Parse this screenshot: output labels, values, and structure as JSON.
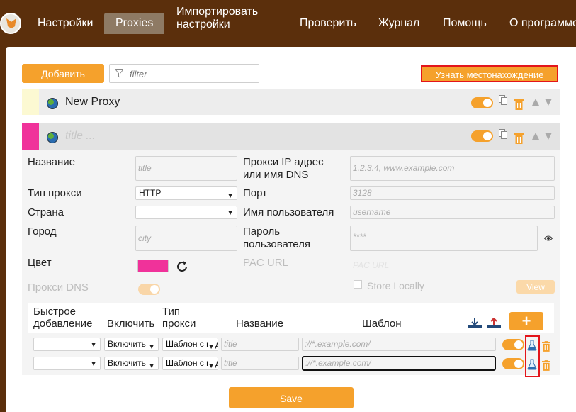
{
  "nav": {
    "tabs": [
      {
        "label": "Настройки"
      },
      {
        "label": "Proxies"
      },
      {
        "label": "Импортировать настройки",
        "line1": "Импортировать",
        "line2": "настройки"
      },
      {
        "label": "Проверить"
      },
      {
        "label": "Журнал"
      },
      {
        "label": "Помощь"
      },
      {
        "label": "О программе"
      }
    ]
  },
  "toolbar": {
    "add_label": "Добавить",
    "filter_placeholder": "filter",
    "locate_label": "Узнать местонахождение"
  },
  "proxies": [
    {
      "title": "New Proxy",
      "color": "#fcf9d2"
    },
    {
      "title_placeholder": "title ...",
      "color": "#f0329a"
    }
  ],
  "form": {
    "name_label": "Название",
    "name_placeholder": "title",
    "host_label_line1": "Прокси IP адрес",
    "host_label_line2": "или имя DNS",
    "host_placeholder": "1.2.3.4, www.example.com",
    "type_label": "Тип прокси",
    "type_value": "HTTP",
    "port_label": "Порт",
    "port_placeholder": "3128",
    "country_label": "Страна",
    "username_label": "Имя пользователя",
    "username_placeholder": "username",
    "city_label": "Город",
    "city_placeholder": "city",
    "password_label_line1": "Пароль",
    "password_label_line2": "пользователя",
    "password_placeholder": "****",
    "color_label": "Цвет",
    "color_value": "#f0329a",
    "pac_label": "PAC URL",
    "pac_placeholder": "PAC URL",
    "dns_label": "Прокси DNS",
    "store_locally_label": "Store Locally",
    "view_label": "View"
  },
  "patterns": {
    "headers": {
      "quick_add_line1": "Быстрое",
      "quick_add_line2": "добавление",
      "enable": "Включить",
      "type_line1": "Тип",
      "type_line2": "прокси",
      "name": "Название",
      "pattern": "Шаблон"
    },
    "add_label": "+",
    "rows": [
      {
        "enable": "Включить",
        "type": "Шаблон с подстановочными знаками",
        "name_placeholder": "title",
        "pattern_placeholder": "://*.example.com/"
      },
      {
        "enable": "Включить",
        "type": "Шаблон с подстановочными знаками",
        "name_placeholder": "title",
        "pattern_placeholder": "://*.example.com/"
      }
    ]
  },
  "save_label": "Save",
  "colors": {
    "accent": "#f5a12c",
    "nav_bg": "#5b2f0c",
    "highlight": "#e3151b"
  }
}
